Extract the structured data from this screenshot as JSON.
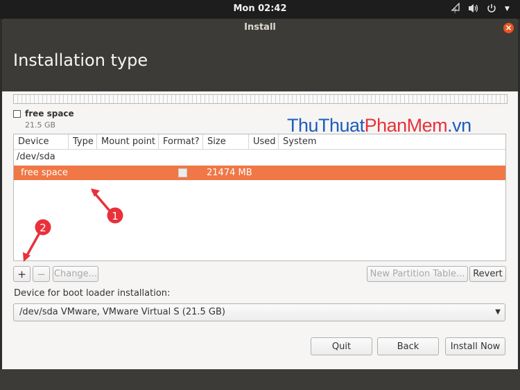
{
  "topbar": {
    "clock": "Mon 02:42"
  },
  "window": {
    "title": "Install"
  },
  "page": {
    "heading": "Installation type"
  },
  "disk_legend": {
    "name": "free space",
    "size": "21.5 GB"
  },
  "watermark": {
    "part1": "ThuThuat",
    "part2": "PhanMem",
    "part3": ".vn"
  },
  "table": {
    "columns": [
      "Device",
      "Type",
      "Mount point",
      "Format?",
      "Size",
      "Used",
      "System"
    ],
    "device_group": "/dev/sda",
    "selected_row": {
      "device": "free space",
      "format_checked": false,
      "size": "21474 MB"
    }
  },
  "buttons": {
    "add": "+",
    "remove": "−",
    "change": "Change...",
    "new_partition_table": "New Partition Table...",
    "revert": "Revert",
    "quit": "Quit",
    "back": "Back",
    "install_now": "Install Now"
  },
  "bootloader": {
    "label": "Device for boot loader installation:",
    "selected": "/dev/sda VMware, VMware Virtual S (21.5 GB)"
  },
  "annotations": {
    "first": "1",
    "second": "2"
  },
  "colors": {
    "accent": "#f07746",
    "annotation_red": "#e8313a",
    "header": "#3c3b37",
    "watermark_blue": "#1e5dbb"
  }
}
